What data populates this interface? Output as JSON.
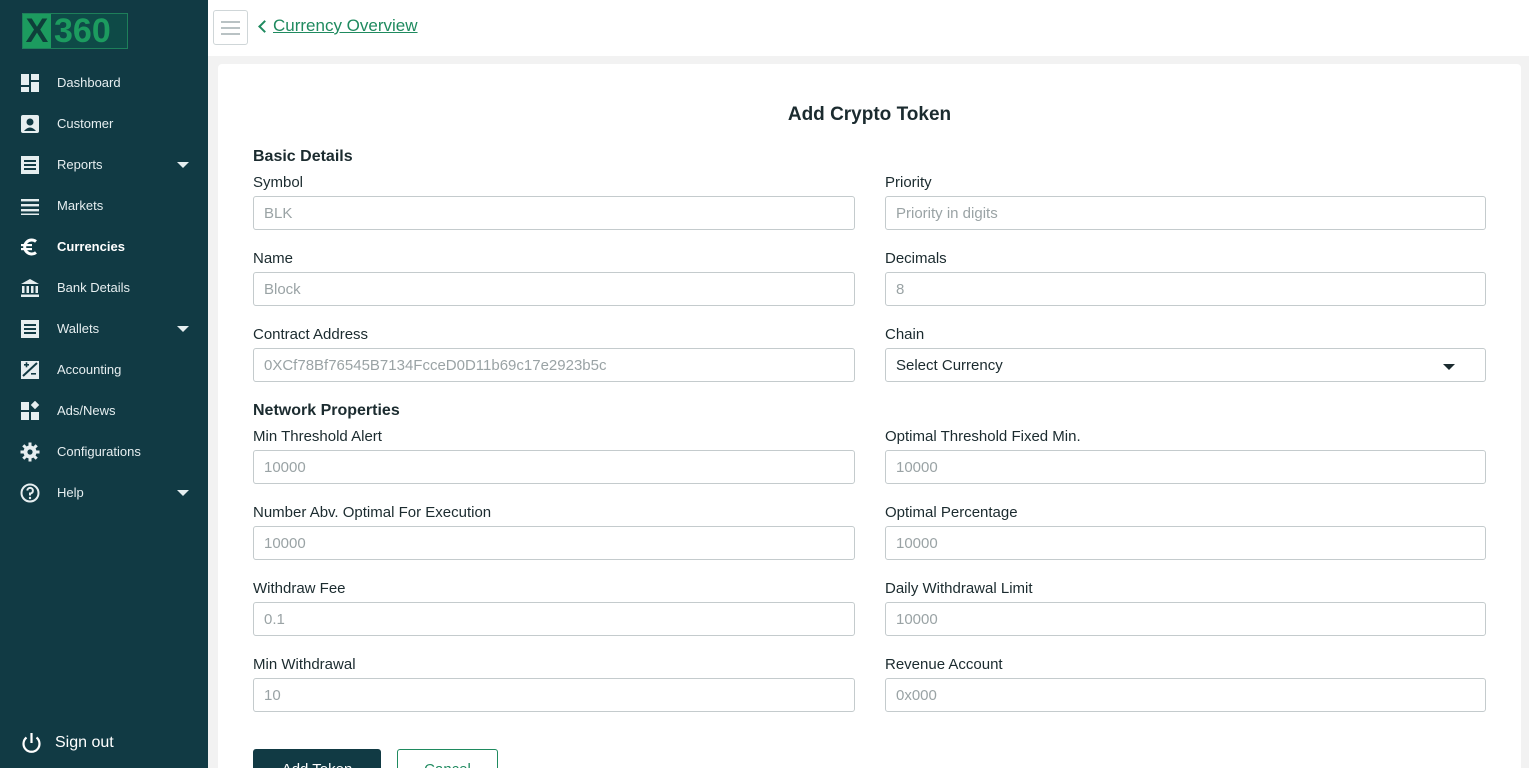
{
  "sidebar": {
    "logo": {
      "x": "X",
      "number": "360"
    },
    "items": [
      {
        "label": "Dashboard",
        "icon": "dashboard-icon",
        "active": false
      },
      {
        "label": "Customer",
        "icon": "customer-icon",
        "active": false
      },
      {
        "label": "Reports",
        "icon": "reports-icon",
        "active": false,
        "has_submenu": true
      },
      {
        "label": "Markets",
        "icon": "markets-icon",
        "active": false
      },
      {
        "label": "Currencies",
        "icon": "euro-icon",
        "active": true
      },
      {
        "label": "Bank Details",
        "icon": "bank-icon",
        "active": false
      },
      {
        "label": "Wallets",
        "icon": "wallet-icon",
        "active": false,
        "has_submenu": true
      },
      {
        "label": "Accounting",
        "icon": "accounting-icon",
        "active": false
      },
      {
        "label": "Ads/News",
        "icon": "ads-icon",
        "active": false
      },
      {
        "label": "Configurations",
        "icon": "gear-icon",
        "active": false
      },
      {
        "label": "Help",
        "icon": "help-icon",
        "active": false,
        "has_submenu": true
      }
    ],
    "signout_label": "Sign out"
  },
  "header": {
    "breadcrumb": "Currency Overview"
  },
  "form": {
    "title": "Add Crypto Token",
    "sections": {
      "basic": "Basic Details",
      "network": "Network Properties"
    },
    "fields": {
      "symbol": {
        "label": "Symbol",
        "placeholder": "BLK"
      },
      "priority": {
        "label": "Priority",
        "placeholder": "Priority in digits"
      },
      "name": {
        "label": "Name",
        "placeholder": "Block"
      },
      "decimals": {
        "label": "Decimals",
        "placeholder": "8"
      },
      "contract_address": {
        "label": "Contract Address",
        "placeholder": "0XCf78Bf76545B7134FcceD0D11b69c17e2923b5c"
      },
      "chain": {
        "label": "Chain",
        "value": "Select Currency"
      },
      "min_threshold_alert": {
        "label": "Min Threshold Alert",
        "placeholder": "10000"
      },
      "optimal_threshold_fixed_min": {
        "label": "Optimal Threshold Fixed Min.",
        "placeholder": "10000"
      },
      "number_abv_optimal": {
        "label": "Number Abv. Optimal For Execution",
        "placeholder": "10000"
      },
      "optimal_percentage": {
        "label": "Optimal Percentage",
        "placeholder": "10000"
      },
      "withdraw_fee": {
        "label": "Withdraw Fee",
        "placeholder": "0.1"
      },
      "daily_withdrawal_limit": {
        "label": "Daily Withdrawal Limit",
        "placeholder": "10000"
      },
      "min_withdrawal": {
        "label": "Min Withdrawal",
        "placeholder": "10"
      },
      "revenue_account": {
        "label": "Revenue Account",
        "placeholder": "0x000"
      }
    },
    "buttons": {
      "submit": "Add Token",
      "cancel": "Cancel"
    }
  },
  "colors": {
    "sidebar_bg": "#113a44",
    "accent": "#1f8a5f",
    "primary_button": "#113a44"
  }
}
